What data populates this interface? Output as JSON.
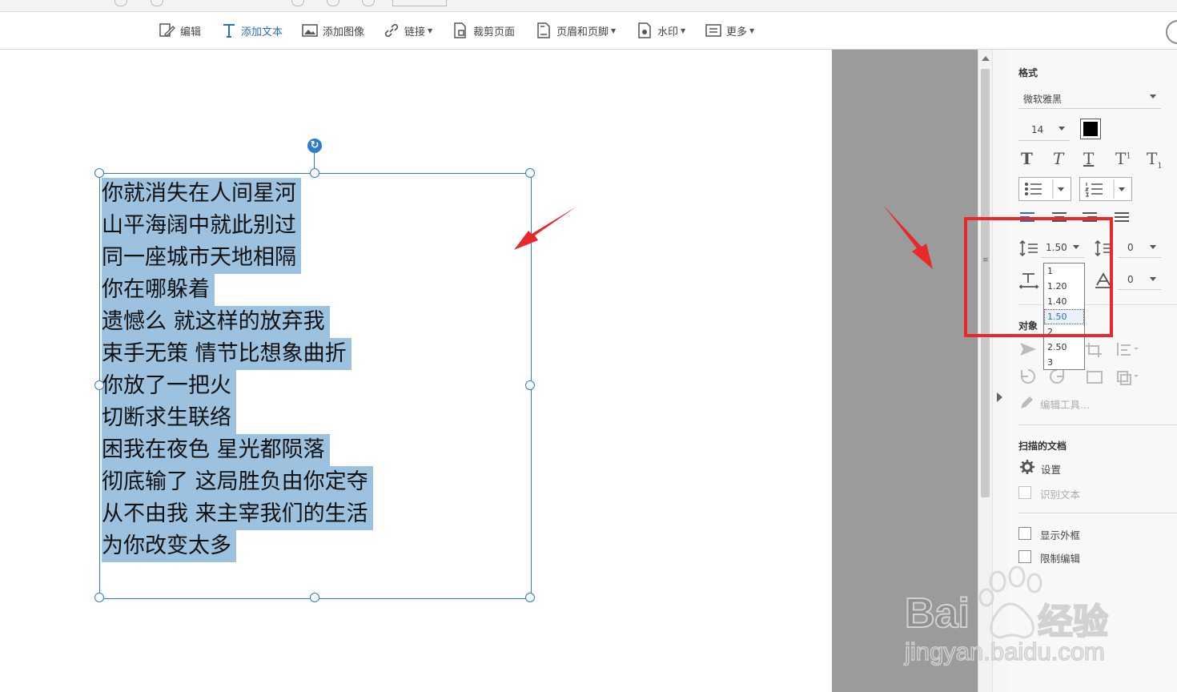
{
  "toolbar": {
    "edit": "编辑",
    "add_text": "添加文本",
    "add_image": "添加图像",
    "link": "链接",
    "crop_page": "裁剪页面",
    "header_footer": "页眉和页脚",
    "watermark": "水印",
    "more": "更多"
  },
  "document": {
    "lines": [
      "你就消失在人间星河",
      "山平海阔中就此别过",
      "同一座城市天地相隔",
      "你在哪躲着",
      "遗憾么 就这样的放弃我",
      "束手无策 情节比想象曲折",
      "你放了一把火",
      "切断求生联络",
      "困我在夜色 星光都陨落",
      "彻底输了 这局胜负由你定夺",
      "从不由我 来主宰我们的生活",
      "为你改变太多"
    ]
  },
  "panel": {
    "format_title": "格式",
    "font_family": "微软雅黑",
    "font_size": "14",
    "text_color": "#000000",
    "line_spacing": "1.50",
    "paragraph_spacing": "0",
    "char_spacing": "0",
    "line_spacing_options": [
      "1",
      "1.20",
      "1.40",
      "1.50",
      "2",
      "2.50",
      "3"
    ],
    "objects_title": "对象",
    "edit_tools": "编辑工具...",
    "scanned_title": "扫描的文档",
    "settings": "设置",
    "recognize_text": "识别文本",
    "show_frame": "显示外框",
    "restrict_edit": "限制编辑"
  },
  "watermark": {
    "brand": "Bai",
    "brand_cn": "经验",
    "url": "jingyan.baidu.com"
  },
  "colors": {
    "accent": "#2a6fb7",
    "selection": "#9dc2df",
    "frame": "#2e7bcf",
    "annotation": "#e8282b"
  }
}
